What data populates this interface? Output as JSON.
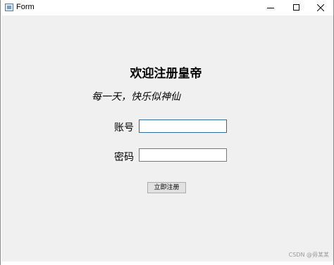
{
  "window": {
    "title": "Form",
    "controls": [
      "minimize",
      "maximize",
      "close"
    ]
  },
  "form": {
    "heading": "欢迎注册皇帝",
    "subtitle": "每一天，快乐似神仙",
    "account_label": "账号",
    "account_value": "",
    "password_label": "密码",
    "password_value": "",
    "register_button": "立即注册"
  },
  "watermark": "CSDN @毋某某",
  "colors": {
    "focus_border": "#0078d7",
    "client_background": "#f0f0f0"
  }
}
